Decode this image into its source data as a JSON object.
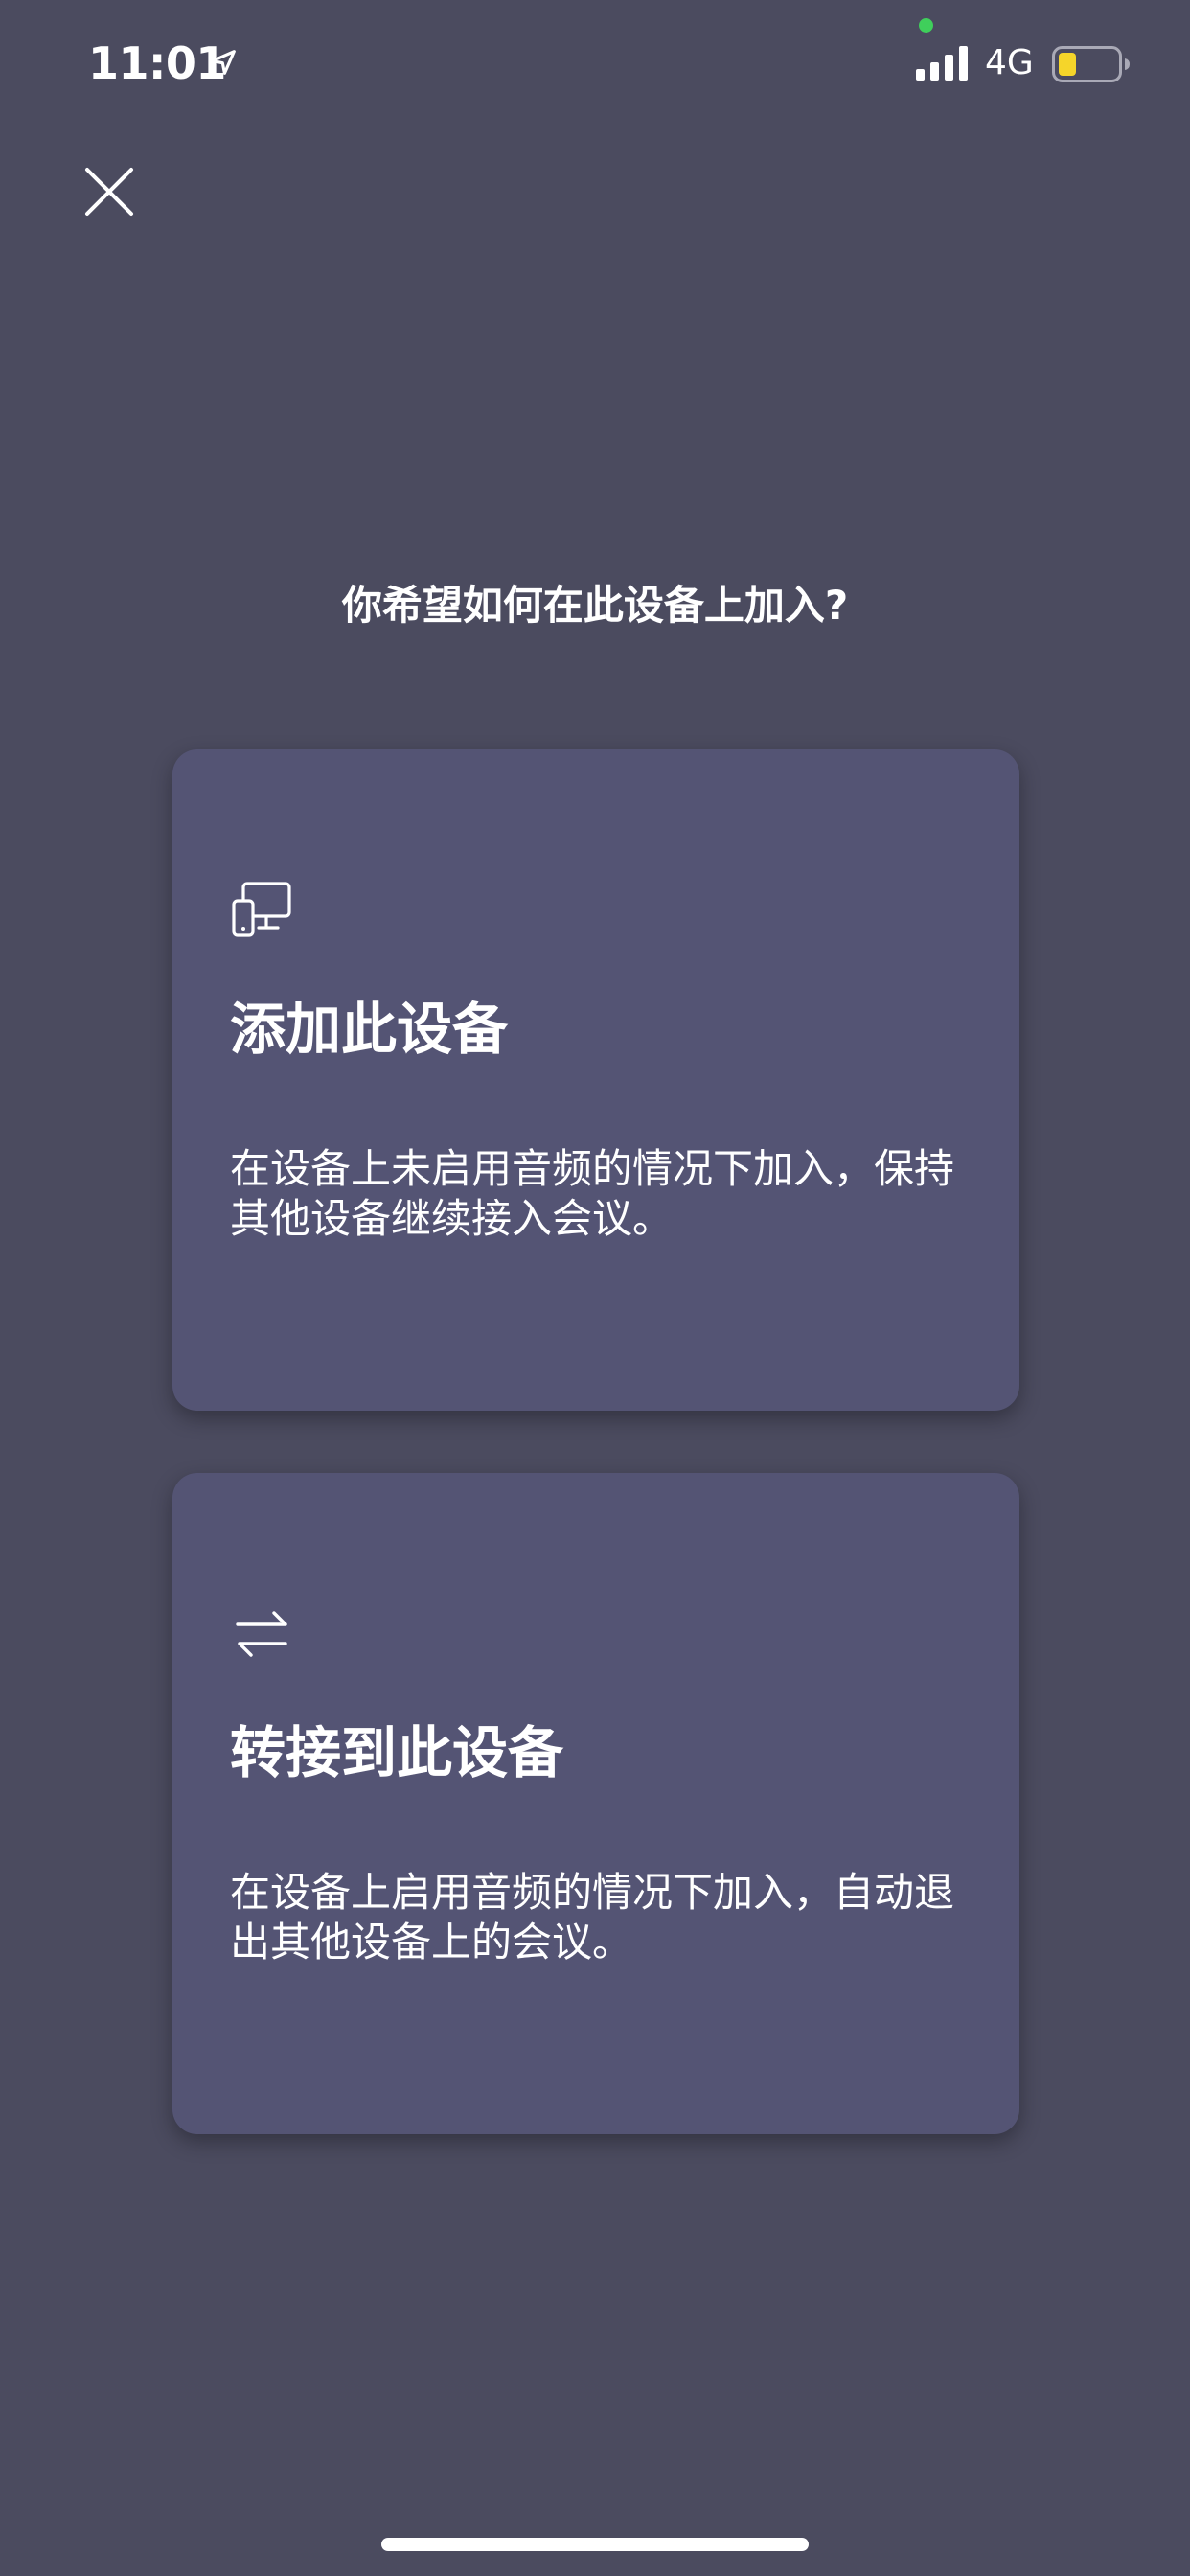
{
  "status_bar": {
    "time": "11:01",
    "network": "4G",
    "icons": [
      "location-arrow-icon",
      "signal-icon",
      "battery-icon"
    ],
    "privacy_indicator_color": "#3fcf5b",
    "battery_fill_color": "#f5d52a"
  },
  "header": {
    "close_icon": "close-icon"
  },
  "page": {
    "title": "你希望如何在此设备上加入?"
  },
  "options": [
    {
      "icon": "device-screen-icon",
      "title": "添加此设备",
      "description": "在设备上未启用音频的情况下加入，保持其他设备继续接入会议。"
    },
    {
      "icon": "transfer-arrows-icon",
      "title": "转接到此设备",
      "description": "在设备上启用音频的情况下加入，自动退出其他设备上的会议。"
    }
  ],
  "colors": {
    "background": "#4b4b5f",
    "card": "#545474",
    "text": "#ffffff"
  }
}
